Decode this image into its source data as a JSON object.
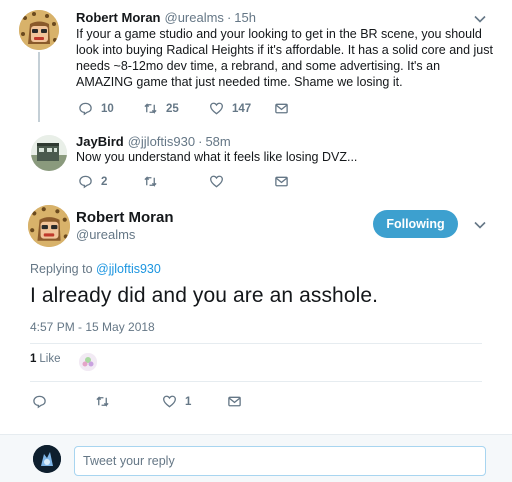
{
  "tweets": [
    {
      "name": "Robert Moran",
      "handle": "@urealms",
      "time": "15h",
      "text": "If your a game studio and your looking to get in the BR scene, you should look into buying Radical Heights if it's affordable. It has a solid core and just needs ~8-12mo dev time, a rebrand, and some advertising. It's an AMAZING game that just needed time. Shame we losing it.",
      "replies": "10",
      "retweets": "25",
      "likes": "147"
    },
    {
      "name": "JayBird",
      "handle": "@jjloftis930",
      "time": "58m",
      "text": "Now you understand what it feels like losing DVZ...",
      "replies": "2"
    }
  ],
  "main_tweet": {
    "name": "Robert Moran",
    "handle": "@urealms",
    "follow_label": "Following",
    "replying_prefix": "Replying to",
    "replying_to": "@jjloftis930",
    "text": "I already did and you are an asshole.",
    "timestamp": "4:57 PM - 15 May 2018",
    "like_count": "1",
    "like_label": "Like",
    "likes": "1"
  },
  "reply_box": {
    "placeholder": "Tweet your reply"
  },
  "icons": {
    "reply": "reply-icon",
    "retweet": "retweet-icon",
    "like": "heart-icon",
    "dm": "envelope-icon",
    "more": "chevron-down-icon"
  },
  "colors": {
    "accent": "#1b95e0",
    "follow_button": "#3da0cf",
    "muted_text": "#657786",
    "thread_line": "#c4cfd6"
  }
}
